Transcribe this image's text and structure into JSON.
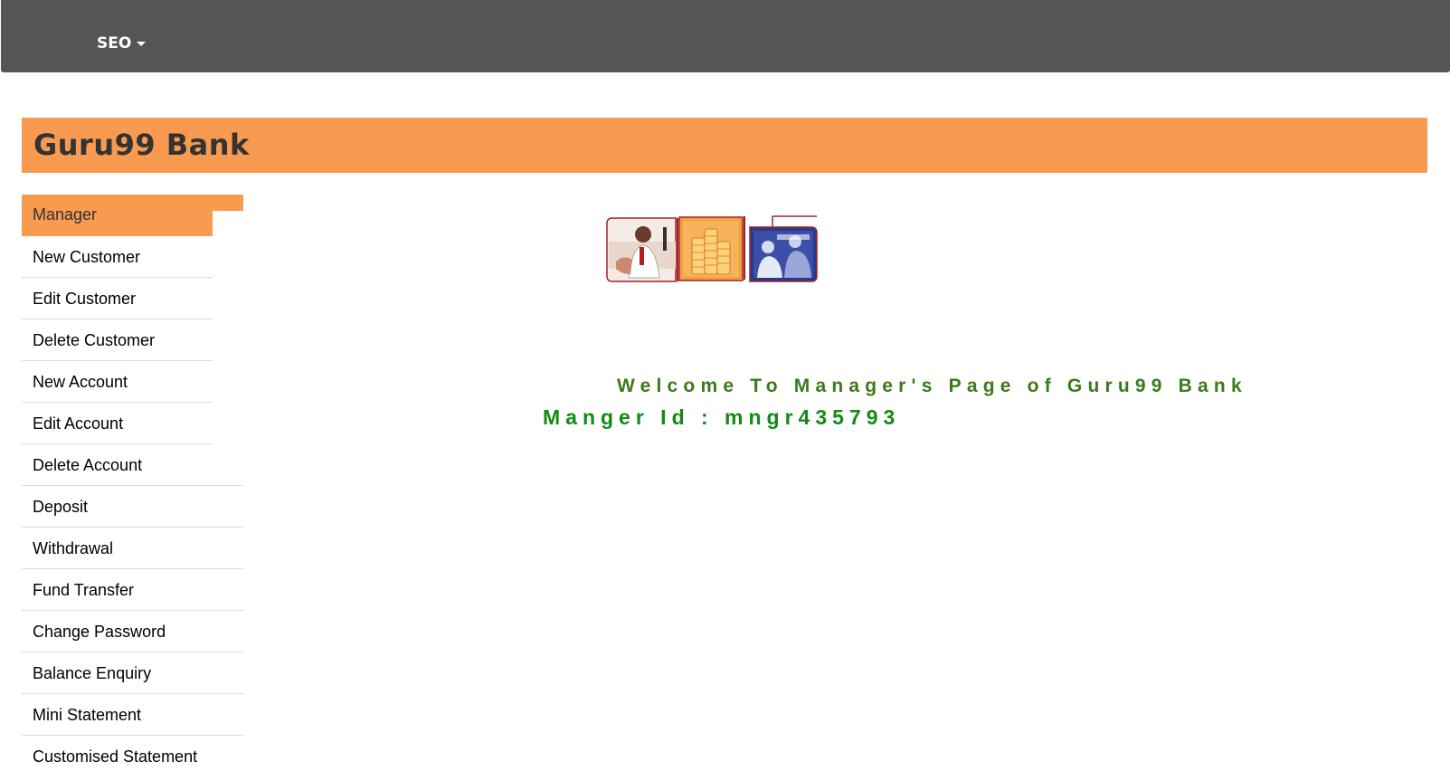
{
  "nav": {
    "menu_label": "SEO"
  },
  "banner": {
    "title": "Guru99 Bank"
  },
  "sidebar": {
    "items": [
      {
        "label": "Manager"
      },
      {
        "label": "New Customer"
      },
      {
        "label": "Edit Customer"
      },
      {
        "label": "Delete Customer"
      },
      {
        "label": "New Account"
      },
      {
        "label": "Edit Account"
      },
      {
        "label": "Delete Account"
      },
      {
        "label": "Deposit"
      },
      {
        "label": "Withdrawal"
      },
      {
        "label": "Fund Transfer"
      },
      {
        "label": "Change Password"
      },
      {
        "label": "Balance Enquiry"
      },
      {
        "label": "Mini Statement"
      },
      {
        "label": "Customised Statement"
      }
    ]
  },
  "main": {
    "welcome_text": "Welcome To Manager's Page of Guru99 Bank",
    "manager_id_text": "Manger Id : mngr435793"
  },
  "colors": {
    "topbar": "#555555",
    "accent": "#f89a50",
    "welcome": "#3a7a1a",
    "manager_id": "#138a13"
  }
}
